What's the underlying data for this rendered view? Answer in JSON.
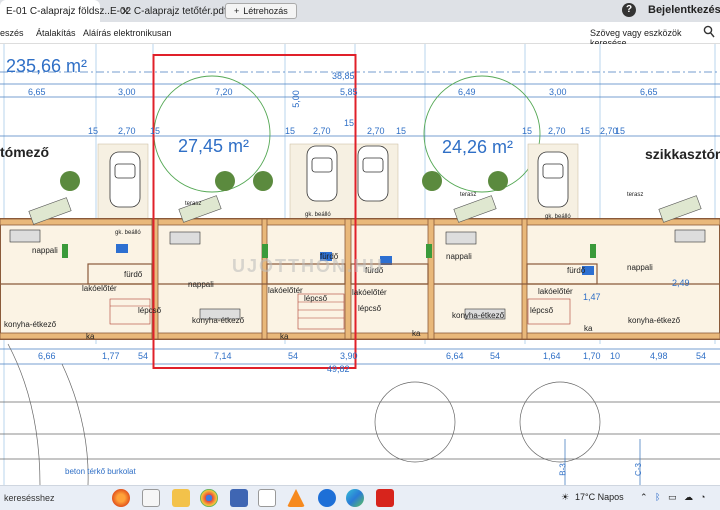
{
  "browser": {
    "tabs": [
      {
        "label": "E-01 C-alaprajz földsz..."
      },
      {
        "label": "E-02 C-alaprajz tetőtér.pdf"
      }
    ],
    "new_tab_label": "Létrehozás",
    "help_label": "?",
    "login_label": "Bejelentkezés"
  },
  "toolbar": {
    "items": [
      "eszés",
      "Átalakítás",
      "Aláírás elektronikusan"
    ],
    "search_label": "Szöveg vagy eszközök keresése"
  },
  "plan": {
    "area_top": "235,66 m²",
    "area_left_room": "27,45 m²",
    "area_right_room": "24,26 m²",
    "label_left_edge": "tómező",
    "label_right_edge": "szikkasztóm",
    "dim_total_top": "38,85",
    "dim_top": [
      "6,65",
      "3,00",
      "7,20",
      "5,00",
      "5,85",
      "6,49",
      "3,00",
      "6,65"
    ],
    "dim_small": [
      "15",
      "2,70",
      "15",
      "15",
      "2,70",
      "15",
      "2,70",
      "15",
      "15",
      "2,70",
      "15",
      "2,70",
      "15"
    ],
    "dim_bottom": [
      "6,66",
      "1,77",
      "54",
      "7,14",
      "54",
      "3,90",
      "6,64",
      "54",
      "1,64",
      "1,70",
      "10",
      "4,98",
      "54"
    ],
    "dim_total_bottom": "49,82",
    "room_labels": [
      "nappali",
      "nappali",
      "nappali",
      "nappali",
      "lakóelőtér",
      "lakóelőtér",
      "lakóelőtér",
      "lakóelőtér",
      "konyha-étkező",
      "konyha-étkező",
      "konyha-étkező",
      "konyha-étkező",
      "lépcső",
      "lépcső",
      "lépcső",
      "lépcső",
      "fürdő",
      "fürdő",
      "fürdő",
      "fürdő",
      "gk. beálló",
      "gk. beálló",
      "gk. beálló",
      "ka",
      "ka",
      "ka",
      "ka",
      "terasz",
      "terasz",
      "terasz"
    ],
    "extra_dims": [
      "1,47",
      "2,49"
    ],
    "paving_label": "beton térkő burkolat",
    "grid_labels": [
      "B-3",
      "C-3"
    ],
    "watermark": "UJOTTHON.HU"
  },
  "taskbar": {
    "search_label": "keresésshez",
    "weather": "17°C  Napos"
  }
}
